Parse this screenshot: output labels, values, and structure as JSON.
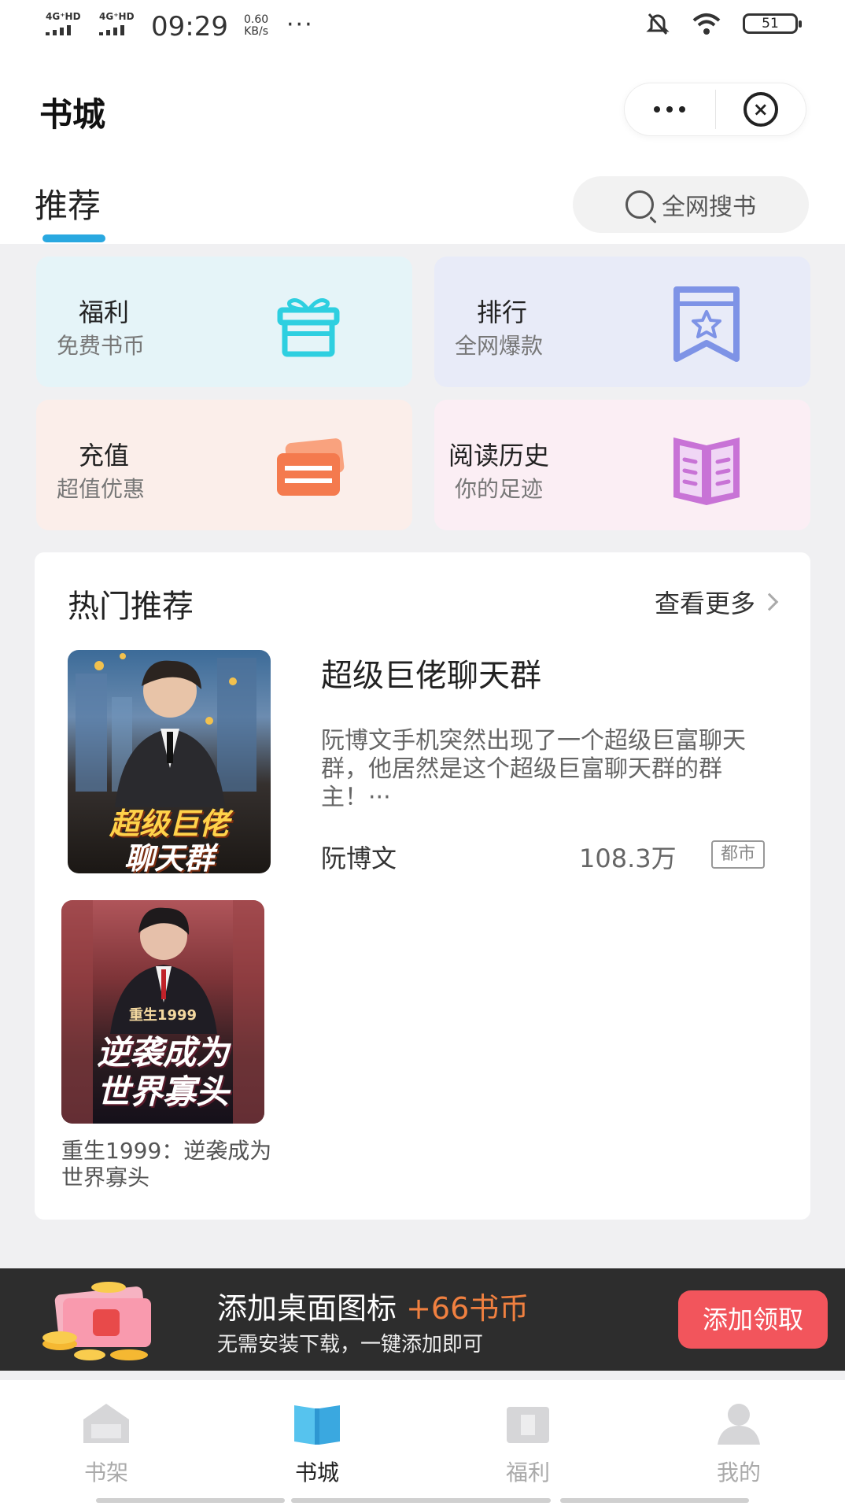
{
  "status_bar": {
    "signal1": "4G⁺HD",
    "signal2": "4G⁺HD",
    "time": "09:29",
    "speed_value": "0.60",
    "speed_unit": "KB/s",
    "dots": "···",
    "battery": "51"
  },
  "header": {
    "title": "书城",
    "tab_recommend": "推荐",
    "search_label": "全网搜书"
  },
  "cards": [
    {
      "title": "福利",
      "sub": "免费书币",
      "icon": "gift-icon",
      "color": "#2ecfe0"
    },
    {
      "title": "排行",
      "sub": "全网爆款",
      "icon": "rank-bookmark-icon",
      "color": "#7e93e6"
    },
    {
      "title": "充值",
      "sub": "超值优惠",
      "icon": "card-icon",
      "color": "#f47a4e"
    },
    {
      "title": "阅读历史",
      "sub": "你的足迹",
      "icon": "open-book-icon",
      "color": "#c873d6"
    }
  ],
  "hot": {
    "title": "热门推荐",
    "more": "查看更多",
    "book1": {
      "cover_text_1": "超级巨佬",
      "cover_text_2": "聊天群",
      "title": "超级巨佬聊天群",
      "desc": "阮博文手机突然出现了一个超级巨富聊天群，他居然是这个超级巨富聊天群的群主！···",
      "author": "阮博文",
      "count": "108.3万",
      "tag": "都市"
    },
    "book2": {
      "cover_small": "重生1999",
      "cover_text_1": "逆袭成为",
      "cover_text_2": "世界寡头",
      "title": "重生1999：逆袭成为世界寡头"
    }
  },
  "promo": {
    "title_main": "添加桌面图标 ",
    "title_bonus": "+66书币",
    "sub": "无需安装下载，一键添加即可",
    "button": "添加领取"
  },
  "nav": [
    {
      "label": "书架",
      "icon": "bookshelf-icon"
    },
    {
      "label": "书城",
      "icon": "bookstore-icon"
    },
    {
      "label": "福利",
      "icon": "welfare-icon"
    },
    {
      "label": "我的",
      "icon": "profile-icon"
    }
  ],
  "colors": {
    "accent": "#29a8e0",
    "promo_button": "#f2555c",
    "promo_bonus": "#f08040"
  }
}
